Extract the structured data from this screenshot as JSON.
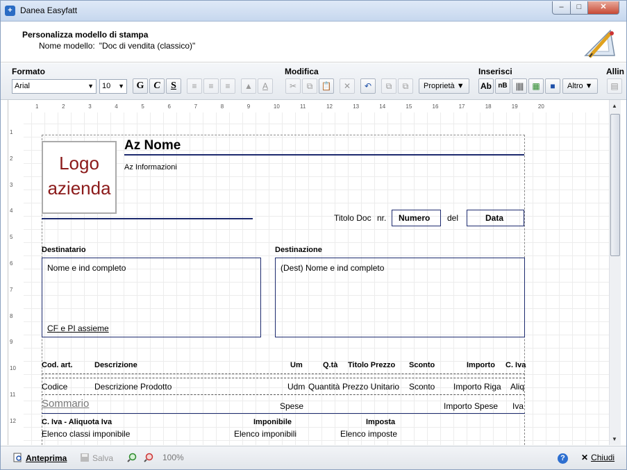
{
  "window": {
    "title": "Danea Easyfatt"
  },
  "header": {
    "title": "Personalizza modello di stampa",
    "model_label": "Nome modello:",
    "model_value": "\"Doc di vendita (classico)\""
  },
  "toolbar": {
    "formato_label": "Formato",
    "modifica_label": "Modifica",
    "inserisci_label": "Inserisci",
    "allinea_label": "Allin",
    "font_value": "Arial",
    "size_value": "10",
    "bold_label": "G",
    "italic_label": "C",
    "underline_label": "S",
    "proprieta_label": "Proprietà",
    "text_btn_label": "Ab",
    "field_btn_label": "nB",
    "altro_label": "Altro"
  },
  "ruler": {
    "top": [
      "1",
      "2",
      "3",
      "4",
      "5",
      "6",
      "7",
      "8",
      "9",
      "10",
      "11",
      "12",
      "13",
      "14",
      "15",
      "16",
      "17",
      "18",
      "19",
      "20"
    ],
    "left": [
      "1",
      "2",
      "3",
      "4",
      "5",
      "6",
      "7",
      "8",
      "9",
      "10",
      "11",
      "12"
    ]
  },
  "design": {
    "logo_line1": "Logo",
    "logo_line2": "azienda",
    "az_nome": "Az Nome",
    "az_info": "Az Informazioni",
    "titolo_doc": "Titolo Doc",
    "nr": "nr.",
    "numero": "Numero",
    "del": "del",
    "data": "Data",
    "destinatario": "Destinatario",
    "destinazione": "Destinazione",
    "nome_ind": "Nome e ind completo",
    "cf_pi": "CF e PI assieme",
    "dest_nome_ind": "(Dest) Nome e ind completo",
    "col_headers": [
      "Cod. art.",
      "Descrizione",
      "Um",
      "Q.tà",
      "Titolo Prezzo",
      "Sconto",
      "Importo",
      "C. Iva"
    ],
    "row_values": [
      "Codice",
      "Descrizione Prodotto",
      "Udm",
      "Quantità",
      "Prezzo Unitario",
      "Sconto",
      "Importo Riga",
      "Aliq"
    ],
    "sommario": "Sommario",
    "spese": "Spese",
    "importo_spese": "Importo Spese",
    "iva": "Iva",
    "civa_header": "C. Iva - Aliquota Iva",
    "imponibile_header": "Imponibile",
    "imposta_header": "Imposta",
    "elenco_classi": "Elenco classi imponibile",
    "elenco_imponibili": "Elenco imponibili",
    "elenco_imposte": "Elenco imposte"
  },
  "statusbar": {
    "anteprima": "Anteprima",
    "salva": "Salva",
    "zoom": "100%",
    "chiudi": "Chiudi"
  }
}
